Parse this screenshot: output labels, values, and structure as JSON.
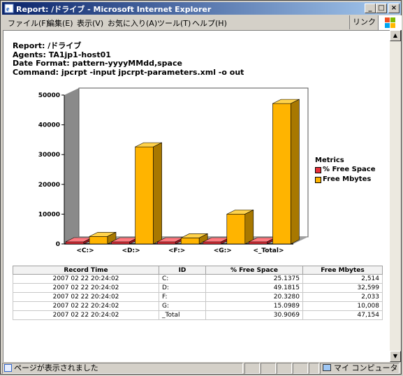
{
  "window": {
    "title": "Report: /ドライブ - Microsoft Internet Explorer",
    "buttons": [
      "_",
      "□",
      "×"
    ]
  },
  "menu": {
    "items": [
      "ファイル(F)",
      "編集(E)",
      "表示(V)",
      "お気に入り(A)",
      "ツール(T)",
      "ヘルプ(H)"
    ],
    "links": "リンク »"
  },
  "report": {
    "line1": "Report: /ドライブ",
    "line2": "Agents: TA1jp1-host01",
    "line3": "Date Format: pattern-yyyyMMdd,space",
    "line4": "Command: jpcrpt -input jpcrpt-parameters.xml -o out"
  },
  "chart_data": {
    "type": "bar",
    "categories": [
      "<C:>",
      "<D:>",
      "<F:>",
      "<G:>",
      "<_Total>"
    ],
    "series": [
      {
        "name": "% Free Space",
        "values": [
          25.1375,
          49.1815,
          20.328,
          15.0989,
          30.9069
        ],
        "color": "#e8303a"
      },
      {
        "name": "Free Mbytes",
        "values": [
          2514,
          32599,
          2033,
          10008,
          47154
        ],
        "color": "#ffb400"
      }
    ],
    "yticks": [
      "0",
      "10000",
      "20000",
      "30000",
      "40000",
      "50000"
    ],
    "ylim": [
      0,
      50000
    ],
    "legend_title": "Metrics",
    "legend_position": "right"
  },
  "table": {
    "headers": [
      "Record Time",
      "ID",
      "% Free Space",
      "Free Mbytes"
    ],
    "rows": [
      [
        "2007 02 22 20:24:02",
        "C:",
        "25.1375",
        "2,514"
      ],
      [
        "2007 02 22 20:24:02",
        "D:",
        "49.1815",
        "32,599"
      ],
      [
        "2007 02 22 20:24:02",
        "F:",
        "20.3280",
        "2,033"
      ],
      [
        "2007 02 22 20:24:02",
        "G:",
        "15.0989",
        "10,008"
      ],
      [
        "2007 02 22 20:24:02",
        "_Total",
        "30.9069",
        "47,154"
      ]
    ]
  },
  "status": {
    "text": "ページが表示されました",
    "zone": "マイ コンピュータ"
  }
}
